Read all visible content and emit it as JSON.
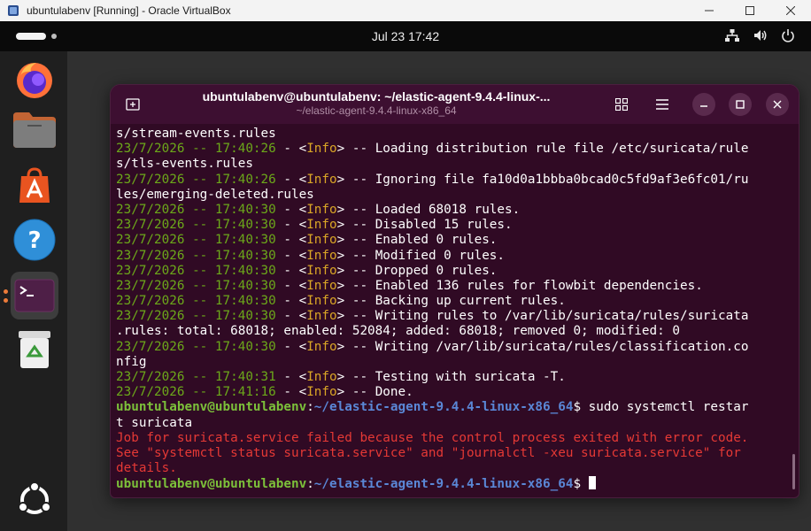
{
  "vbox": {
    "title": "ubuntulabenv [Running] - Oracle VirtualBox",
    "controls": [
      "minimize-icon",
      "maximize-icon",
      "close-icon"
    ]
  },
  "panel": {
    "clock": "Jul 23  17:42",
    "tray": [
      "network-icon",
      "volume-icon",
      "power-icon"
    ]
  },
  "dock": {
    "items": [
      "firefox-icon",
      "files-icon",
      "app-center-icon",
      "help-icon",
      "terminal-icon",
      "trash-icon",
      "show-apps-icon"
    ]
  },
  "terminal": {
    "title": "ubuntulabenv@ubuntulabenv: ~/elastic-agent-9.4.4-linux-...",
    "subtitle": "~/elastic-agent-9.4.4-linux-x86_64",
    "lines": [
      {
        "type": "plain",
        "text": "s/stream-events.rules"
      },
      {
        "type": "log",
        "ts": "23/7/2026 -- 17:40:26",
        "sep1": " - <",
        "tag": "Info",
        "sep2": "> -- ",
        "msg": "Loading distribution rule file /etc/suricata/rule"
      },
      {
        "type": "plain",
        "text": "s/tls-events.rules"
      },
      {
        "type": "log",
        "ts": "23/7/2026 -- 17:40:26",
        "sep1": " - <",
        "tag": "Info",
        "sep2": "> -- ",
        "msg": "Ignoring file fa10d0a1bbba0bcad0c5fd9af3e6fc01/ru"
      },
      {
        "type": "plain",
        "text": "les/emerging-deleted.rules"
      },
      {
        "type": "log",
        "ts": "23/7/2026 -- 17:40:30",
        "sep1": " - <",
        "tag": "Info",
        "sep2": "> -- ",
        "msg": "Loaded 68018 rules."
      },
      {
        "type": "log",
        "ts": "23/7/2026 -- 17:40:30",
        "sep1": " - <",
        "tag": "Info",
        "sep2": "> -- ",
        "msg": "Disabled 15 rules."
      },
      {
        "type": "log",
        "ts": "23/7/2026 -- 17:40:30",
        "sep1": " - <",
        "tag": "Info",
        "sep2": "> -- ",
        "msg": "Enabled 0 rules."
      },
      {
        "type": "log",
        "ts": "23/7/2026 -- 17:40:30",
        "sep1": " - <",
        "tag": "Info",
        "sep2": "> -- ",
        "msg": "Modified 0 rules."
      },
      {
        "type": "log",
        "ts": "23/7/2026 -- 17:40:30",
        "sep1": " - <",
        "tag": "Info",
        "sep2": "> -- ",
        "msg": "Dropped 0 rules."
      },
      {
        "type": "log",
        "ts": "23/7/2026 -- 17:40:30",
        "sep1": " - <",
        "tag": "Info",
        "sep2": "> -- ",
        "msg": "Enabled 136 rules for flowbit dependencies."
      },
      {
        "type": "log",
        "ts": "23/7/2026 -- 17:40:30",
        "sep1": " - <",
        "tag": "Info",
        "sep2": "> -- ",
        "msg": "Backing up current rules."
      },
      {
        "type": "log",
        "ts": "23/7/2026 -- 17:40:30",
        "sep1": " - <",
        "tag": "Info",
        "sep2": "> -- ",
        "msg": "Writing rules to /var/lib/suricata/rules/suricata"
      },
      {
        "type": "plain",
        "text": ".rules: total: 68018; enabled: 52084; added: 68018; removed 0; modified: 0"
      },
      {
        "type": "log",
        "ts": "23/7/2026 -- 17:40:30",
        "sep1": " - <",
        "tag": "Info",
        "sep2": "> -- ",
        "msg": "Writing /var/lib/suricata/rules/classification.co"
      },
      {
        "type": "plain",
        "text": "nfig"
      },
      {
        "type": "log",
        "ts": "23/7/2026 -- 17:40:31",
        "sep1": " - <",
        "tag": "Info",
        "sep2": "> -- ",
        "msg": "Testing with suricata -T."
      },
      {
        "type": "log",
        "ts": "23/7/2026 -- 17:41:16",
        "sep1": " - <",
        "tag": "Info",
        "sep2": "> -- ",
        "msg": "Done."
      },
      {
        "type": "prompt",
        "user": "ubuntulabenv@ubuntulabenv",
        "colon": ":",
        "path": "~/elastic-agent-9.4.4-linux-x86_64",
        "dollar": "$ ",
        "cmd": "sudo systemctl restar"
      },
      {
        "type": "plain",
        "text": "t suricata"
      },
      {
        "type": "error",
        "text": "Job for suricata.service failed because the control process exited with error code."
      },
      {
        "type": "error",
        "text": "See \"systemctl status suricata.service\" and \"journalctl -xeu suricata.service\" for"
      },
      {
        "type": "error",
        "text": "details."
      },
      {
        "type": "prompt-cursor",
        "user": "ubuntulabenv@ubuntulabenv",
        "colon": ":",
        "path": "~/elastic-agent-9.4.4-linux-x86_64",
        "dollar": "$ "
      }
    ]
  },
  "colors": {
    "terminal_bg": "#300a24",
    "timestamp": "#6ca81a",
    "info_tag": "#d9a526",
    "prompt_user": "#7cc03a",
    "prompt_path": "#5a87d6",
    "error": "#e53935",
    "running_indicator": "#ec7b3a"
  }
}
